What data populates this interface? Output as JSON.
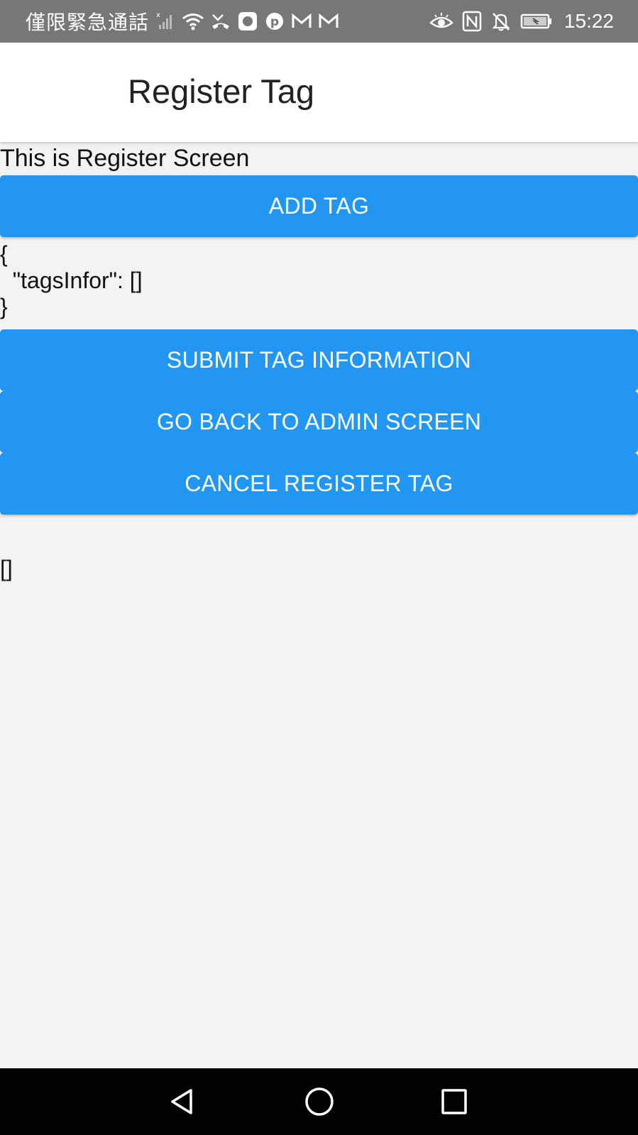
{
  "status_bar": {
    "carrier_text": "僅限緊急通話",
    "time": "15:22",
    "icons_left": [
      "signal-icon",
      "wifi-icon",
      "missed-call-icon",
      "app-notification-icon",
      "pinterest-icon",
      "gmail-icon",
      "gmail-icon"
    ],
    "icons_right": [
      "eye-icon",
      "nfc-icon",
      "bell-off-icon",
      "battery-icon"
    ]
  },
  "app_bar": {
    "title": "Register Tag"
  },
  "content": {
    "screen_text": "This is Register Screen",
    "add_tag_label": "ADD TAG",
    "json_text": "{\n  \"tagsInfor\": []\n}",
    "submit_label": "SUBMIT TAG INFORMATION",
    "go_back_label": "GO BACK TO ADMIN SCREEN",
    "cancel_label": "CANCEL REGISTER TAG",
    "array_text": "[]"
  },
  "nav_bar": {
    "icons": [
      "back-icon",
      "home-icon",
      "recents-icon"
    ]
  },
  "colors": {
    "accent": "#2196f3",
    "status_bar": "#777777",
    "background": "#f2f2f2",
    "nav_bar": "#000000"
  }
}
